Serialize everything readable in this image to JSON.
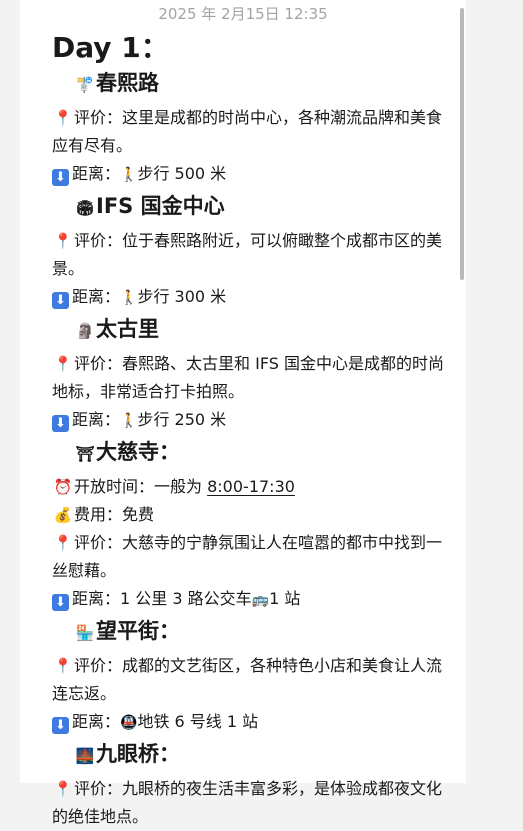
{
  "timestamp": "2025 年 2月15日 12:35",
  "day_title": "Day 1：",
  "sections": [
    {
      "icon": "bus-stop-icon",
      "icon_glyph": "🚏",
      "name": "春熙路",
      "rating_label": "评价：",
      "rating": "这里是成都的时尚中心，各种潮流品牌和美食应有尽有。",
      "distance_label": "距离：",
      "distance": "步行 500 米",
      "distance_glyph": "🚶"
    },
    {
      "icon": "stadium-icon",
      "icon_glyph": "🏟",
      "name": "IFS 国金中心",
      "rating_label": "评价：",
      "rating": "位于春熙路附近，可以俯瞰整个成都市区的美景。",
      "distance_label": "距离：",
      "distance": "步行 300 米",
      "distance_glyph": "🚶"
    },
    {
      "icon": "moai-icon",
      "icon_glyph": "🗿",
      "name": "太古里",
      "rating_label": "评价：",
      "rating": "春熙路、太古里和 IFS 国金中心是成都的时尚地标，非常适合打卡拍照。",
      "distance_label": "距离：",
      "distance": "步行 250 米",
      "distance_glyph": "🚶"
    },
    {
      "icon": "temple-icon",
      "icon_glyph": "⛩",
      "name": "大慈寺：",
      "hours_label": "开放时间：",
      "hours_prefix": "一般为 ",
      "hours": "8:00-17:30",
      "fee_label": "费用：",
      "fee": "免费",
      "rating_label": "评价：",
      "rating": "大慈寺的宁静氛围让人在喧嚣的都市中找到一丝慰藉。",
      "distance_label": "距离：",
      "distance": "1 公里 3 路公交车",
      "distance_glyph_after": "🚌",
      "distance_suffix": "1 站"
    },
    {
      "icon": "shop-icon",
      "icon_glyph": "🏪",
      "name": "望平街：",
      "rating_label": "评价：",
      "rating": "成都的文艺街区，各种特色小店和美食让人流连忘返。",
      "distance_label": "距离：",
      "distance_glyph": "🚇",
      "distance": "地铁 6 号线 1 站"
    },
    {
      "icon": "bridge-night-icon",
      "icon_glyph": "🌉",
      "name": "九眼桥：",
      "rating_label": "评价：",
      "rating": "九眼桥的夜生活丰富多彩，是体验成都夜文化的绝佳地点。"
    }
  ]
}
